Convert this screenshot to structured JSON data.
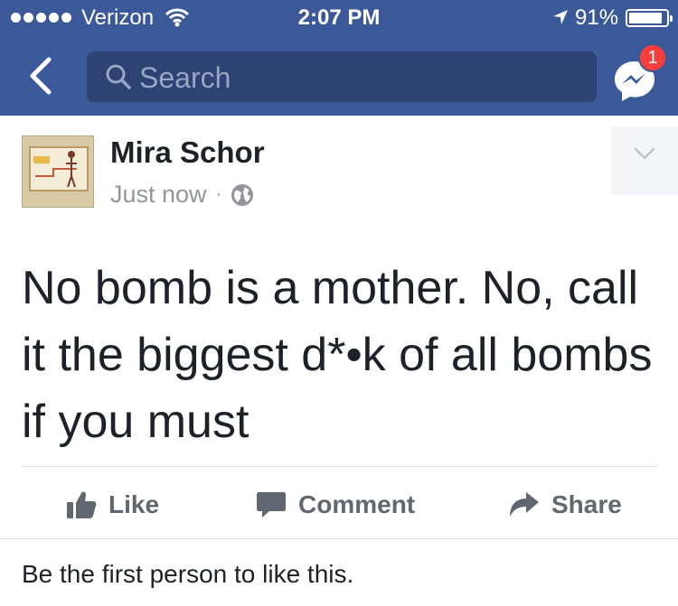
{
  "status_bar": {
    "carrier": "Verizon",
    "time": "2:07 PM",
    "battery_percent": "91%",
    "battery_level": 0.91
  },
  "nav": {
    "search_placeholder": "Search",
    "messenger_badge": "1"
  },
  "post": {
    "author": "Mira Schor",
    "timestamp": "Just now",
    "separator": "·",
    "text": "No bomb is a mother.  No, call it the biggest d*•k of all bombs if you must"
  },
  "actions": {
    "like_label": "Like",
    "comment_label": "Comment",
    "share_label": "Share"
  },
  "likes_summary": "Be the first person to like this.",
  "colors": {
    "brand": "#3b5998",
    "search_bg": "#2c4373",
    "badge": "#fa3e3e",
    "action_text": "#616770"
  }
}
